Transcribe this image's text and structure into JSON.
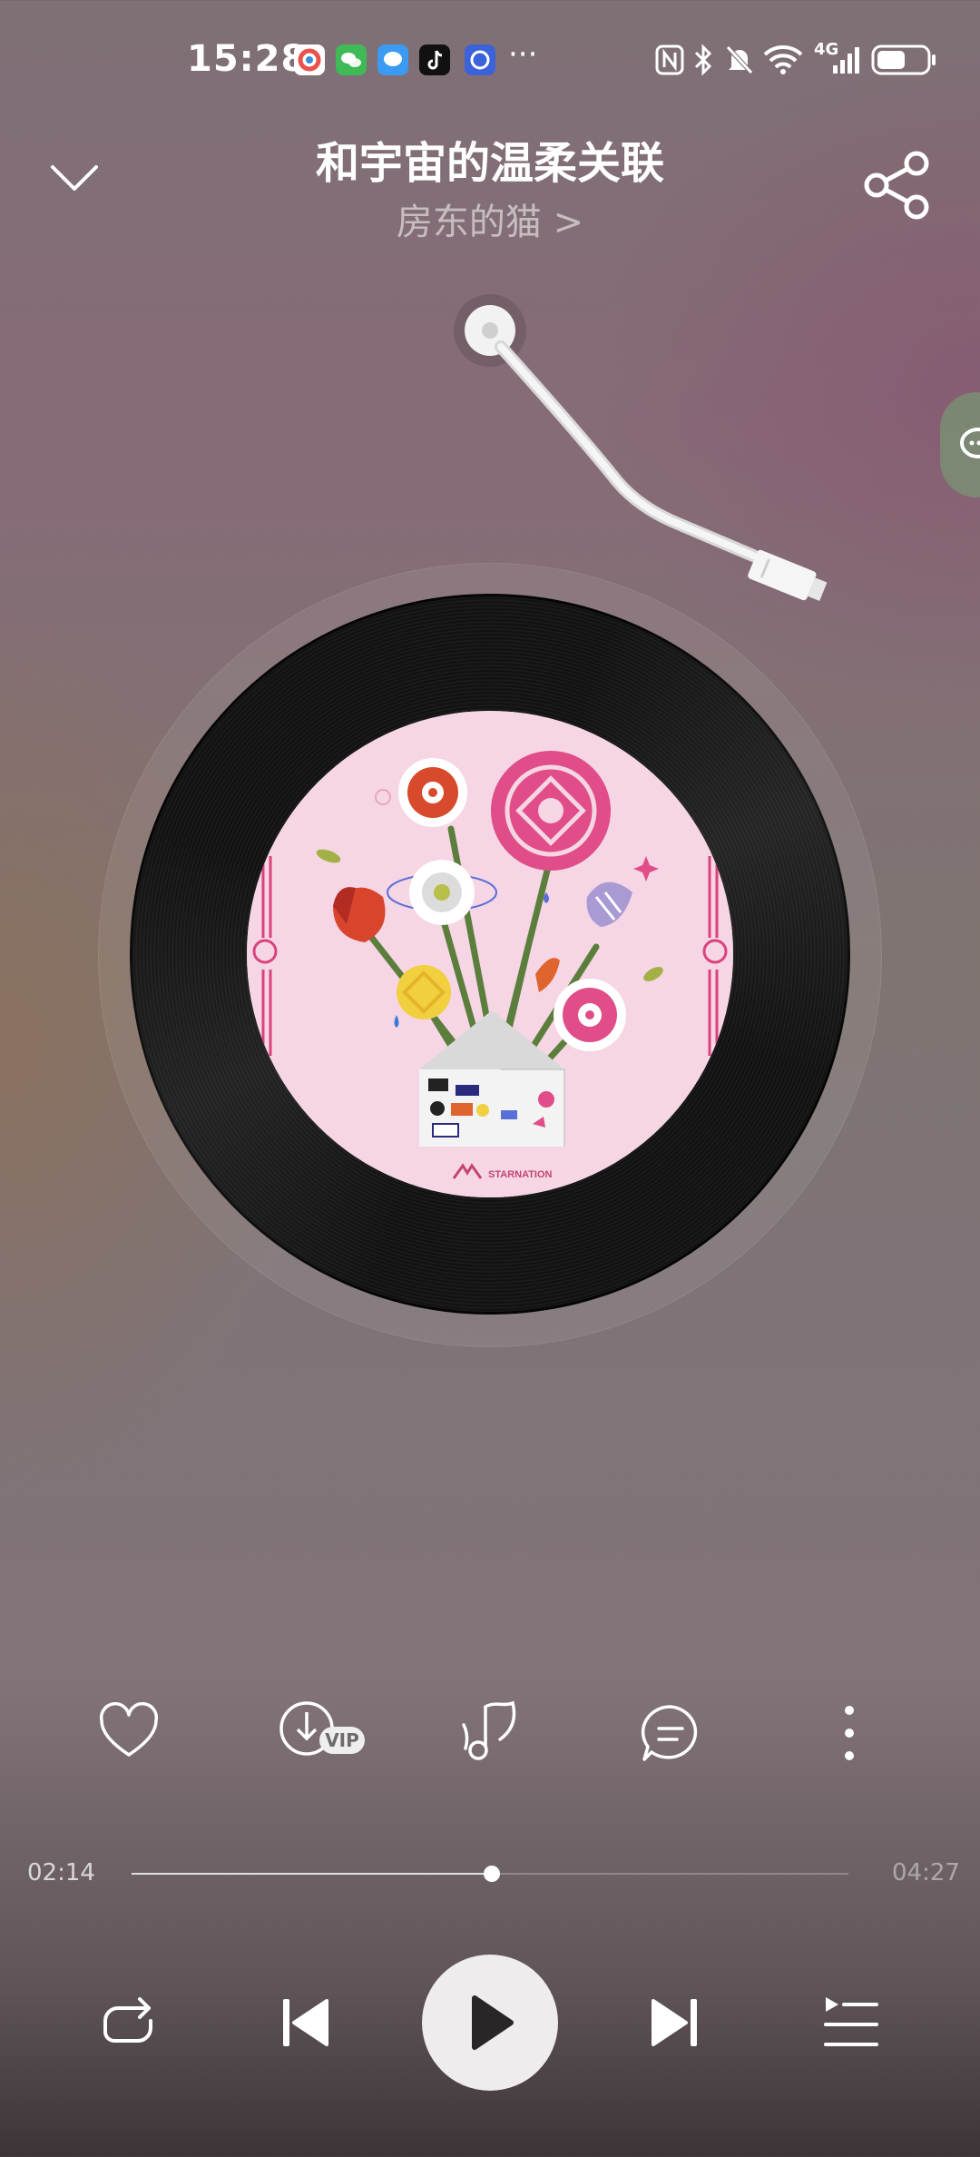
{
  "status_bar": {
    "time": "15:28",
    "app_icons": [
      "app-store-icon",
      "wechat-icon",
      "messages-icon",
      "tiktok-icon",
      "app-icon"
    ],
    "more_indicator": "···",
    "network_label": "4G"
  },
  "header": {
    "title": "和宇宙的温柔关联",
    "artist": "房东的猫 >"
  },
  "album_art": {
    "publisher_logo": "STARNATION"
  },
  "actions": {
    "vip_badge": "VIP"
  },
  "playback": {
    "current_time": "02:14",
    "total_time": "04:27",
    "progress": 0.502
  },
  "colors": {
    "accent": "#ffffff",
    "cover_bg": "#f5d5e3",
    "rose_pink": "#e04d88",
    "play_button": "#efecee"
  }
}
